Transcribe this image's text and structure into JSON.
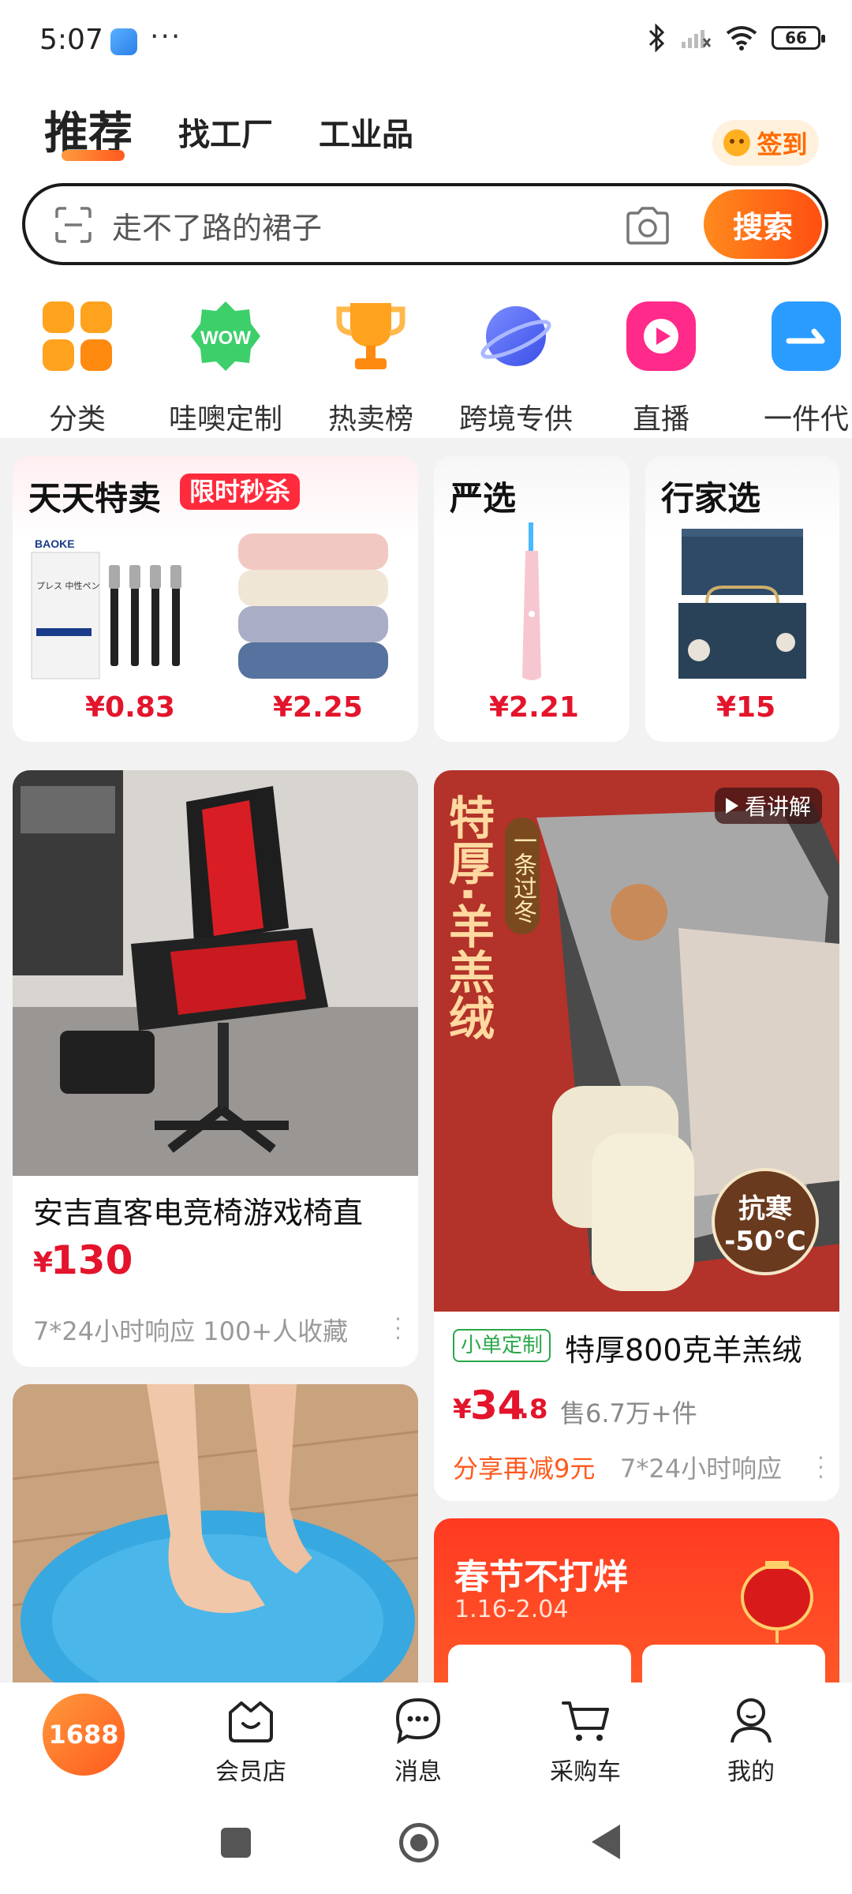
{
  "status_bar": {
    "time": "5:07",
    "dots": "···",
    "battery": "66"
  },
  "header": {
    "tabs": [
      "推荐",
      "找工厂",
      "工业品"
    ],
    "signin_label": "签到"
  },
  "search": {
    "placeholder": "走不了路的裙子",
    "button_label": "搜索"
  },
  "quick_nav": [
    {
      "label": "分类",
      "icon": "category-grid-icon"
    },
    {
      "label": "哇噢定制",
      "icon": "wow-badge-icon"
    },
    {
      "label": "热卖榜",
      "icon": "trophy-icon"
    },
    {
      "label": "跨境专供",
      "icon": "planet-icon"
    },
    {
      "label": "直播",
      "icon": "live-play-icon"
    },
    {
      "label": "一件代",
      "icon": "forward-arrow-icon"
    }
  ],
  "promos": {
    "daily_deal": {
      "title": "天天特卖",
      "badge": "限时秒杀",
      "prices": [
        "¥0.83",
        "¥2.25"
      ],
      "pen_brand": "BAOKE",
      "pen_box_text": "プレス 中性ペン"
    },
    "strict_select": {
      "title": "严选",
      "price": "¥2.21"
    },
    "expert_select": {
      "title": "行家选",
      "price": "¥15"
    }
  },
  "feed": {
    "chair": {
      "title": "安吉直客电竞椅游戏椅直",
      "price_symbol": "¥",
      "price": "130",
      "meta": "7*24小时响应  100+人收藏"
    },
    "pants": {
      "watch_label": "看讲解",
      "vertical_text_1": "特厚·羊羔绒",
      "vertical_text_2": "一条过冬",
      "cold_badge_1": "抗寒",
      "cold_badge_2": "-50°C",
      "custom_tag": "小单定制",
      "title": "特厚800克羊羔绒",
      "price_symbol": "¥",
      "price_int": "34",
      "price_dec": ".8",
      "sold": "售6.7万+件",
      "share_promo": "分享再减9元",
      "response": "7*24小时响应"
    },
    "festival": {
      "title": "春节不打烊",
      "dates": "1.16-2.04"
    }
  },
  "bottom_nav": [
    {
      "label": "1688",
      "icon": "home-1688-logo"
    },
    {
      "label": "会员店",
      "icon": "member-store-icon"
    },
    {
      "label": "消息",
      "icon": "message-icon"
    },
    {
      "label": "采购车",
      "icon": "cart-icon"
    },
    {
      "label": "我的",
      "icon": "profile-icon"
    }
  ],
  "colors": {
    "accent": "#ff5a1e",
    "price": "#e3142b",
    "badge_red": "#ff2a3c"
  }
}
